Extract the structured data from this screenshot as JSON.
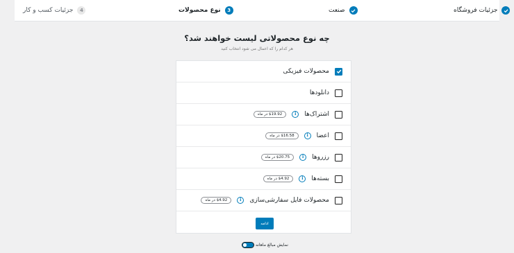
{
  "stepper": {
    "steps": [
      {
        "number": "4",
        "label": "جزئیات کسب و کار",
        "state": "pending"
      },
      {
        "number": "3",
        "label": "نوع محصولات",
        "state": "active"
      },
      {
        "number": "",
        "label": "صنعت",
        "state": "complete"
      },
      {
        "number": "",
        "label": "جزئیات فروشگاه",
        "state": "complete"
      }
    ]
  },
  "header": {
    "title": "چه نوع محصولاتی لیست خواهند شد؟",
    "subtitle": "هر کدام را که اعمال می شود انتخاب کنید"
  },
  "products": [
    {
      "label": "محصولات فیزیکی",
      "checked": true
    },
    {
      "label": "دانلودها",
      "checked": false
    },
    {
      "label": "اشتراک‌ها",
      "checked": false,
      "price": "$19.92 در ماه"
    },
    {
      "label": "اعضا",
      "checked": false,
      "price": "$16.58 در ماه"
    },
    {
      "label": "رزروها",
      "checked": false,
      "price": "$20.75 در ماه"
    },
    {
      "label": "بسته‌ها",
      "checked": false,
      "price": "$4.92 در ماه"
    },
    {
      "label": "محصولات فایل سفارشی‌سازی",
      "checked": false,
      "price": "$4.92 در ماه"
    }
  ],
  "actions": {
    "continue_label": "ادامه"
  },
  "footer": {
    "toggle_label": "نمایش مبالغ ماهانه",
    "toggle_on": true
  },
  "colors": {
    "accent": "#007cba",
    "background": "#f0f0f1"
  }
}
